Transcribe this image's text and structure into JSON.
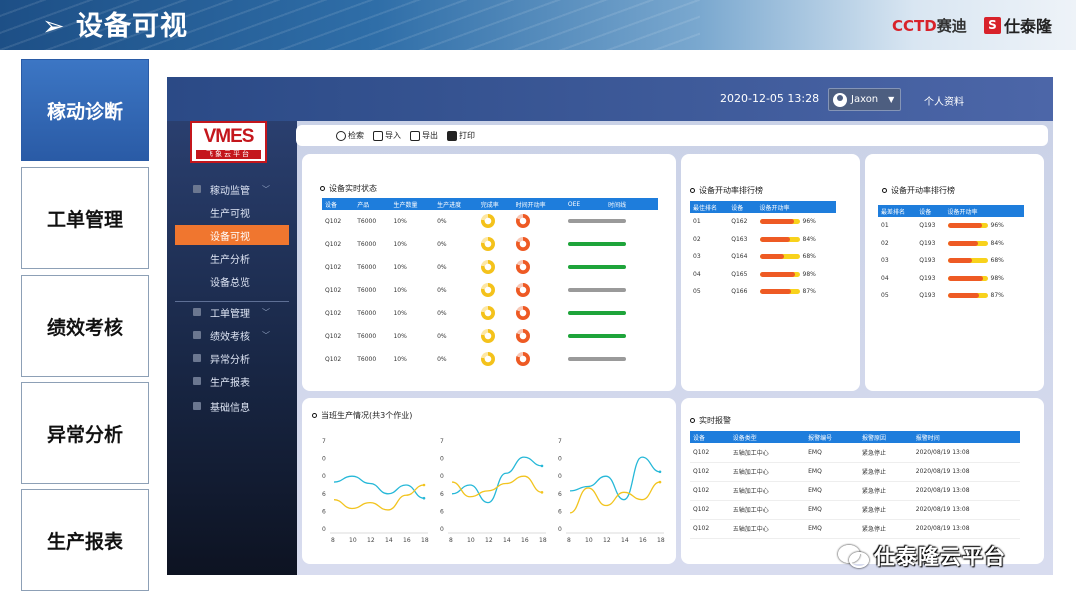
{
  "banner": {
    "title": "设备可视",
    "brand1": "CCTD",
    "brand1_suffix": "赛迪",
    "brand2_logo": "S",
    "brand2": "仕泰隆"
  },
  "left_menu": [
    {
      "label": "稼动诊断",
      "active": true
    },
    {
      "label": "工单管理",
      "active": false
    },
    {
      "label": "绩效考核",
      "active": false
    },
    {
      "label": "异常分析",
      "active": false
    },
    {
      "label": "生产报表",
      "active": false
    }
  ],
  "header": {
    "datetime": "2020-12-05 13:28",
    "user": "Jaxon",
    "profile": "个人资料"
  },
  "logo": {
    "text": "VMES",
    "subtext": "飞象云平台"
  },
  "sidebar": {
    "items": [
      {
        "label": "稼动监管",
        "type": "group"
      },
      {
        "label": "生产可视",
        "type": "sub"
      },
      {
        "label": "设备可视",
        "type": "sub",
        "selected": true
      },
      {
        "label": "生产分析",
        "type": "sub"
      },
      {
        "label": "设备总览",
        "type": "sub"
      },
      {
        "label": "工单管理",
        "type": "group"
      },
      {
        "label": "绩效考核",
        "type": "group"
      },
      {
        "label": "异常分析",
        "type": "item"
      },
      {
        "label": "生产报表",
        "type": "item"
      },
      {
        "label": "基础信息",
        "type": "item"
      }
    ]
  },
  "toolbar": {
    "search": "检索",
    "import": "导入",
    "export": "导出",
    "print": "打印"
  },
  "realtime_status": {
    "title": "设备实时状态",
    "columns": [
      "设备",
      "产品",
      "生产数量",
      "生产进度",
      "完成率",
      "时间开动率",
      "OEE",
      "时间线"
    ],
    "rows": [
      {
        "device": "Q102",
        "product": "T6000",
        "qty": "10%",
        "progress": "0%",
        "oee": "gray"
      },
      {
        "device": "Q102",
        "product": "T6000",
        "qty": "10%",
        "progress": "0%",
        "oee": "green"
      },
      {
        "device": "Q102",
        "product": "T6000",
        "qty": "10%",
        "progress": "0%",
        "oee": "green"
      },
      {
        "device": "Q102",
        "product": "T6000",
        "qty": "10%",
        "progress": "0%",
        "oee": "gray"
      },
      {
        "device": "Q102",
        "product": "T6000",
        "qty": "10%",
        "progress": "0%",
        "oee": "green"
      },
      {
        "device": "Q102",
        "product": "T6000",
        "qty": "10%",
        "progress": "0%",
        "oee": "green"
      },
      {
        "device": "Q102",
        "product": "T6000",
        "qty": "10%",
        "progress": "0%",
        "oee": "gray"
      }
    ]
  },
  "rank_best": {
    "title": "设备开动率排行榜",
    "columns": [
      "最佳排名",
      "设备",
      "设备开动率"
    ],
    "rows": [
      {
        "rank": "01",
        "device": "Q162",
        "value": 96,
        "label": "96%"
      },
      {
        "rank": "02",
        "device": "Q163",
        "value": 84,
        "label": "84%"
      },
      {
        "rank": "03",
        "device": "Q164",
        "value": 68,
        "label": "68%"
      },
      {
        "rank": "04",
        "device": "Q165",
        "value": 98,
        "label": "98%"
      },
      {
        "rank": "05",
        "device": "Q166",
        "value": 87,
        "label": "87%"
      }
    ]
  },
  "rank_worst": {
    "title": "设备开动率排行榜",
    "columns": [
      "最差排名",
      "设备",
      "设备开动率"
    ],
    "rows": [
      {
        "rank": "01",
        "device": "Q193",
        "value": 96,
        "label": "96%"
      },
      {
        "rank": "02",
        "device": "Q193",
        "value": 84,
        "label": "84%"
      },
      {
        "rank": "03",
        "device": "Q193",
        "value": 68,
        "label": "68%"
      },
      {
        "rank": "04",
        "device": "Q193",
        "value": 98,
        "label": "98%"
      },
      {
        "rank": "05",
        "device": "Q193",
        "value": 87,
        "label": "87%"
      }
    ]
  },
  "production": {
    "title": "当班生产情况(共3个作业)"
  },
  "chart_data": [
    {
      "type": "line",
      "x": [
        8,
        10,
        12,
        14,
        16,
        18
      ],
      "ytick_labels": [
        "7",
        "0",
        "0",
        "6",
        "6",
        "0"
      ],
      "series": [
        {
          "color": "#26b8d8",
          "values": [
            3.2,
            3.6,
            3.1,
            2.4,
            3.0,
            2.1
          ]
        },
        {
          "color": "#f2c41f",
          "values": [
            2.0,
            1.4,
            1.8,
            1.3,
            2.3,
            3.0
          ]
        }
      ]
    },
    {
      "type": "line",
      "x": [
        8,
        10,
        12,
        14,
        16,
        18
      ],
      "ytick_labels": [
        "7",
        "0",
        "0",
        "6",
        "6",
        "0"
      ],
      "series": [
        {
          "color": "#26b8d8",
          "values": [
            2.4,
            3.0,
            1.8,
            3.8,
            4.9,
            4.3
          ]
        },
        {
          "color": "#f2c41f",
          "values": [
            3.2,
            2.2,
            2.6,
            3.1,
            3.6,
            2.5
          ]
        }
      ]
    },
    {
      "type": "line",
      "x": [
        8,
        10,
        12,
        14,
        16,
        18
      ],
      "ytick_labels": [
        "7",
        "0",
        "0",
        "6",
        "6",
        "0"
      ],
      "series": [
        {
          "color": "#26b8d8",
          "values": [
            2.6,
            2.9,
            3.6,
            2.0,
            4.9,
            3.9
          ]
        },
        {
          "color": "#f2c41f",
          "values": [
            1.1,
            2.8,
            1.6,
            2.5,
            2.0,
            3.2
          ]
        }
      ]
    }
  ],
  "alarms": {
    "title": "实时报警",
    "columns": [
      "设备",
      "设备类型",
      "报警编号",
      "报警原因",
      "报警时间"
    ],
    "rows": [
      [
        "Q102",
        "五轴加工中心",
        "EMQ",
        "紧急停止",
        "2020/08/19 13:08"
      ],
      [
        "Q102",
        "五轴加工中心",
        "EMQ",
        "紧急停止",
        "2020/08/19 13:08"
      ],
      [
        "Q102",
        "五轴加工中心",
        "EMQ",
        "紧急停止",
        "2020/08/19 13:08"
      ],
      [
        "Q102",
        "五轴加工中心",
        "EMQ",
        "紧急停止",
        "2020/08/19 13:08"
      ],
      [
        "Q102",
        "五轴加工中心",
        "EMQ",
        "紧急停止",
        "2020/08/19 13:08"
      ]
    ]
  },
  "watermark": "仕泰隆云平台"
}
